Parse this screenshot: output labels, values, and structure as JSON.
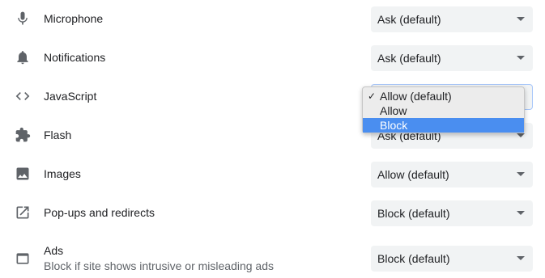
{
  "settings": [
    {
      "label": "Microphone",
      "icon": "microphone-icon",
      "value": "Ask (default)"
    },
    {
      "label": "Notifications",
      "icon": "bell-icon",
      "value": "Ask (default)"
    },
    {
      "label": "JavaScript",
      "icon": "code-icon",
      "value": ""
    },
    {
      "label": "Flash",
      "icon": "puzzle-icon",
      "value": "Ask (default)"
    },
    {
      "label": "Images",
      "icon": "image-icon",
      "value": "Allow (default)"
    },
    {
      "label": "Pop-ups and redirects",
      "icon": "open-external-icon",
      "value": "Block (default)"
    },
    {
      "label": "Ads",
      "sublabel": "Block if site shows intrusive or misleading ads",
      "icon": "ads-window-icon",
      "value": "Block (default)"
    }
  ],
  "javascript_dropdown": {
    "options": [
      {
        "label": "Allow (default)",
        "checked": true,
        "highlighted": false
      },
      {
        "label": "Allow",
        "checked": false,
        "highlighted": false
      },
      {
        "label": "Block",
        "checked": false,
        "highlighted": true
      }
    ],
    "checkmark": "✓"
  },
  "colors": {
    "text": "#202124",
    "secondary_text": "#5f6368",
    "select_bg": "#f1f3f4",
    "icon": "#5f6368",
    "highlight": "#4a8ef0"
  }
}
